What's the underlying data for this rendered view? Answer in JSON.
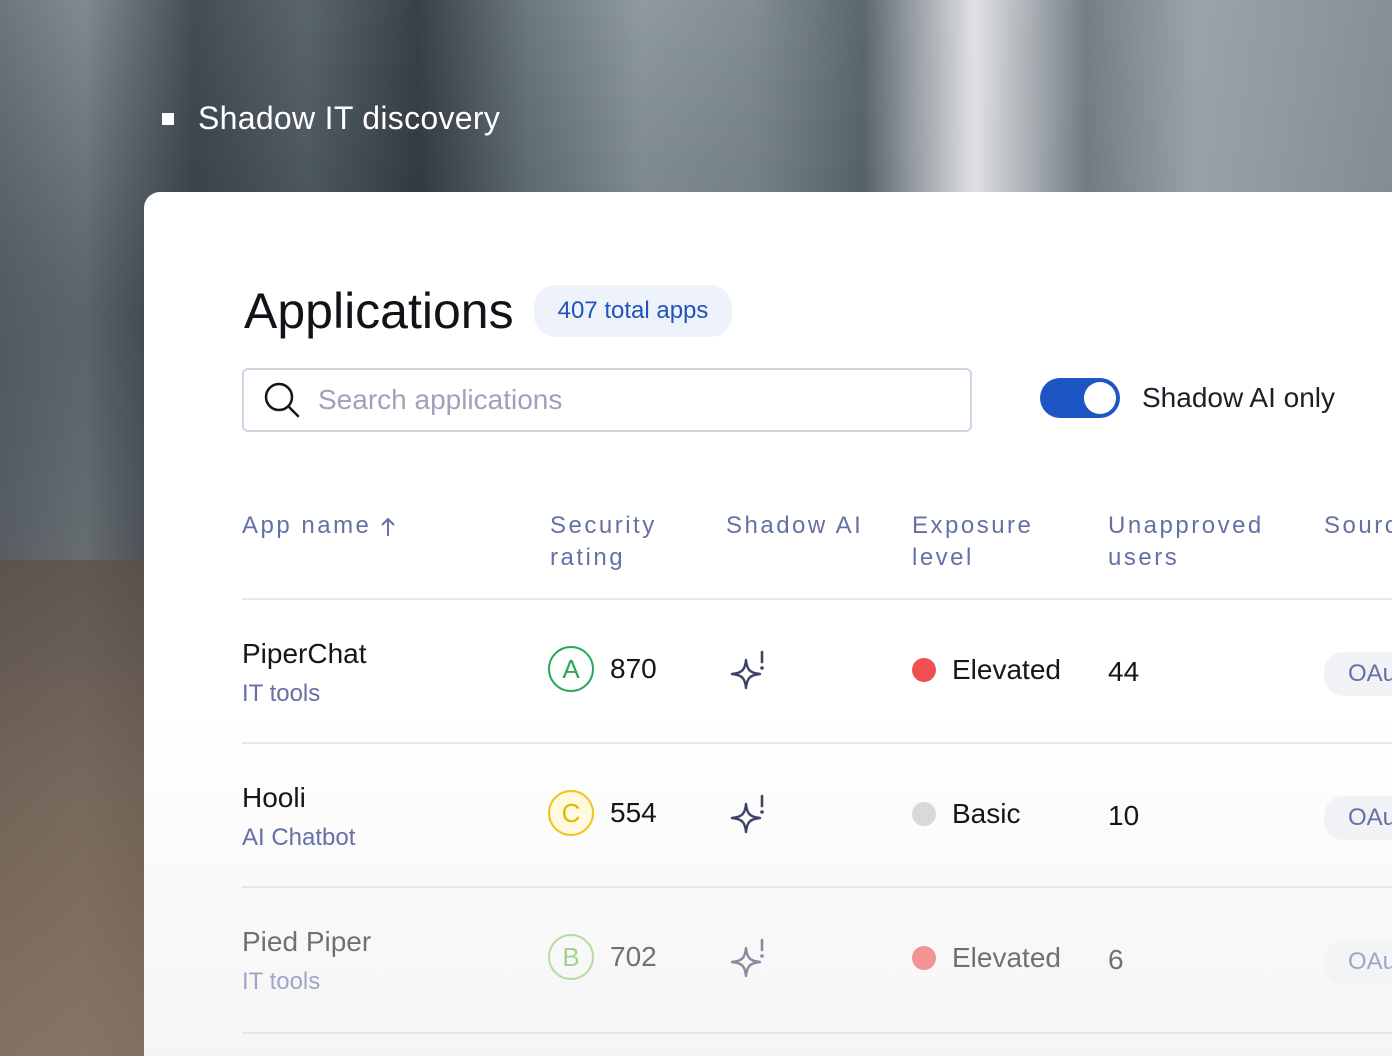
{
  "eyebrow": {
    "label": "Shadow IT discovery"
  },
  "header": {
    "title": "Applications",
    "count_label": "407 total apps"
  },
  "search": {
    "placeholder": "Search applications",
    "value": ""
  },
  "toggle": {
    "label": "Shadow AI only",
    "on": true
  },
  "table": {
    "columns": {
      "app_name": "App name",
      "security_rating": "Security rating",
      "shadow_ai": "Shadow AI",
      "exposure_level": "Exposure level",
      "unapproved_users": "Unapproved users",
      "source": "Sourc"
    },
    "rows": [
      {
        "name": "PiperChat",
        "category": "IT tools",
        "grade": "A",
        "score": "870",
        "exposure": "Elevated",
        "users": "44",
        "source": "OAu"
      },
      {
        "name": "Hooli",
        "category": "AI Chatbot",
        "grade": "C",
        "score": "554",
        "exposure": "Basic",
        "users": "10",
        "source": "OAu"
      },
      {
        "name": "Pied Piper",
        "category": "IT tools",
        "grade": "B",
        "score": "702",
        "exposure": "Elevated",
        "users": "6",
        "source": "OAu"
      }
    ]
  },
  "colors": {
    "accent": "#1d55c4",
    "grade_a": "#2aa95a",
    "grade_b": "#8ccb6a",
    "grade_c": "#f2c418",
    "grade_c_fill": "#fff9e0",
    "exposure_elevated": "#ef4f52",
    "exposure_basic": "#d9d9dc"
  },
  "icons": {
    "search": "search-icon",
    "sort": "arrow-up-icon",
    "shadow_ai": "sparkle-alert-icon"
  }
}
